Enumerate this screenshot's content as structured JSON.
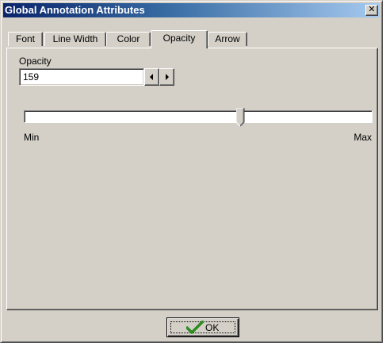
{
  "window": {
    "title": "Global Annotation Attributes",
    "close_label": "✕"
  },
  "tabs": [
    {
      "label": "Font",
      "active": false
    },
    {
      "label": "Line Width",
      "active": false
    },
    {
      "label": "Color",
      "active": false
    },
    {
      "label": "Opacity",
      "active": true
    },
    {
      "label": "Arrow",
      "active": false
    }
  ],
  "opacity": {
    "label": "Opacity",
    "value": "159",
    "slider_value": 159,
    "slider_min": 0,
    "slider_max": 255,
    "min_label": "Min",
    "max_label": "Max"
  },
  "buttons": {
    "ok_label": "OK",
    "ok_icon": "check-icon"
  },
  "colors": {
    "title_gradient_start": "#0a246a",
    "title_gradient_end": "#a6caf0",
    "face": "#d4d0c8",
    "check_green": "#2e8b22"
  }
}
